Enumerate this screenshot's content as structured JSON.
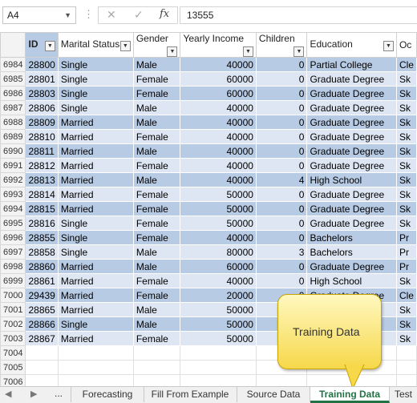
{
  "formula_bar": {
    "name_box": "A4",
    "formula": "13555",
    "cancel_icon": "✕",
    "enter_icon": "✓",
    "fx_label": "fx"
  },
  "headers": [
    "ID",
    "Marital Status",
    "Gender",
    "Yearly Income",
    "Children",
    "Education",
    "Oc"
  ],
  "rows": [
    {
      "row": "6984",
      "id": "28800",
      "marital": "Single",
      "gender": "Male",
      "income": "40000",
      "children": "0",
      "education": "Partial College",
      "occ": "Cle"
    },
    {
      "row": "6985",
      "id": "28801",
      "marital": "Single",
      "gender": "Female",
      "income": "60000",
      "children": "0",
      "education": "Graduate Degree",
      "occ": "Sk"
    },
    {
      "row": "6986",
      "id": "28803",
      "marital": "Single",
      "gender": "Female",
      "income": "60000",
      "children": "0",
      "education": "Graduate Degree",
      "occ": "Sk"
    },
    {
      "row": "6987",
      "id": "28806",
      "marital": "Single",
      "gender": "Male",
      "income": "40000",
      "children": "0",
      "education": "Graduate Degree",
      "occ": "Sk"
    },
    {
      "row": "6988",
      "id": "28809",
      "marital": "Married",
      "gender": "Male",
      "income": "40000",
      "children": "0",
      "education": "Graduate Degree",
      "occ": "Sk"
    },
    {
      "row": "6989",
      "id": "28810",
      "marital": "Married",
      "gender": "Female",
      "income": "40000",
      "children": "0",
      "education": "Graduate Degree",
      "occ": "Sk"
    },
    {
      "row": "6990",
      "id": "28811",
      "marital": "Married",
      "gender": "Male",
      "income": "40000",
      "children": "0",
      "education": "Graduate Degree",
      "occ": "Sk"
    },
    {
      "row": "6991",
      "id": "28812",
      "marital": "Married",
      "gender": "Female",
      "income": "40000",
      "children": "0",
      "education": "Graduate Degree",
      "occ": "Sk"
    },
    {
      "row": "6992",
      "id": "28813",
      "marital": "Married",
      "gender": "Male",
      "income": "40000",
      "children": "4",
      "education": "High School",
      "occ": "Sk"
    },
    {
      "row": "6993",
      "id": "28814",
      "marital": "Married",
      "gender": "Female",
      "income": "50000",
      "children": "0",
      "education": "Graduate Degree",
      "occ": "Sk"
    },
    {
      "row": "6994",
      "id": "28815",
      "marital": "Married",
      "gender": "Female",
      "income": "50000",
      "children": "0",
      "education": "Graduate Degree",
      "occ": "Sk"
    },
    {
      "row": "6995",
      "id": "28816",
      "marital": "Single",
      "gender": "Female",
      "income": "50000",
      "children": "0",
      "education": "Graduate Degree",
      "occ": "Sk"
    },
    {
      "row": "6996",
      "id": "28855",
      "marital": "Single",
      "gender": "Female",
      "income": "40000",
      "children": "0",
      "education": "Bachelors",
      "occ": "Pr"
    },
    {
      "row": "6997",
      "id": "28858",
      "marital": "Single",
      "gender": "Male",
      "income": "80000",
      "children": "3",
      "education": "Bachelors",
      "occ": "Pr"
    },
    {
      "row": "6998",
      "id": "28860",
      "marital": "Married",
      "gender": "Male",
      "income": "60000",
      "children": "0",
      "education": "Graduate Degree",
      "occ": "Pr"
    },
    {
      "row": "6999",
      "id": "28861",
      "marital": "Married",
      "gender": "Female",
      "income": "40000",
      "children": "0",
      "education": "High School",
      "occ": "Sk"
    },
    {
      "row": "7000",
      "id": "29439",
      "marital": "Married",
      "gender": "Female",
      "income": "20000",
      "children": "0",
      "education": "Graduate Degree",
      "occ": "Cle"
    },
    {
      "row": "7001",
      "id": "28865",
      "marital": "Married",
      "gender": "Male",
      "income": "50000",
      "children": "",
      "education": "",
      "occ": "Sk"
    },
    {
      "row": "7002",
      "id": "28866",
      "marital": "Single",
      "gender": "Male",
      "income": "50000",
      "children": "",
      "education": "",
      "occ": "Sk"
    },
    {
      "row": "7003",
      "id": "28867",
      "marital": "Married",
      "gender": "Female",
      "income": "50000",
      "children": "",
      "education": "",
      "occ": "Sk"
    }
  ],
  "empty_rows": [
    "7004",
    "7005",
    "7006"
  ],
  "sheet_tabs": {
    "ellipsis": "...",
    "tabs": [
      "Forecasting",
      "Fill From Example",
      "Source Data",
      "Training Data",
      "Test"
    ],
    "active": "Training Data"
  },
  "callout": {
    "text": "Training Data"
  },
  "colors": {
    "band_dark": "#b8cbe4",
    "band_light": "#dde6f2",
    "active_tab": "#217346",
    "callout": "#f6d84a"
  }
}
